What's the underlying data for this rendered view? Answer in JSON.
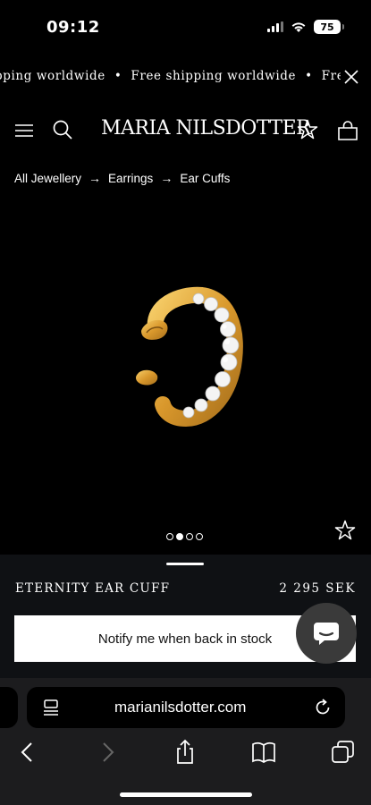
{
  "status_bar": {
    "time": "09:12",
    "battery": "75"
  },
  "announcement": {
    "items": [
      "pping worldwide",
      "Free shipping worldwide",
      "Free"
    ],
    "separator": "•"
  },
  "header": {
    "logo": "MARIA NILSDOTTER"
  },
  "breadcrumb": {
    "items": [
      "All Jewellery",
      "Earrings",
      "Ear Cuffs"
    ],
    "separator": "→"
  },
  "product": {
    "name": "ETERNITY EAR CUFF",
    "price": "2 295 SEK",
    "notify_label": "Notify me when back in stock",
    "image_count": 4,
    "active_image": 2
  },
  "browser": {
    "url": "marianilsdotter.com"
  },
  "colors": {
    "background": "#000000",
    "sheet": "#0f1114",
    "gold": "#e3a83a",
    "browser_chrome": "#1c1c1e"
  }
}
